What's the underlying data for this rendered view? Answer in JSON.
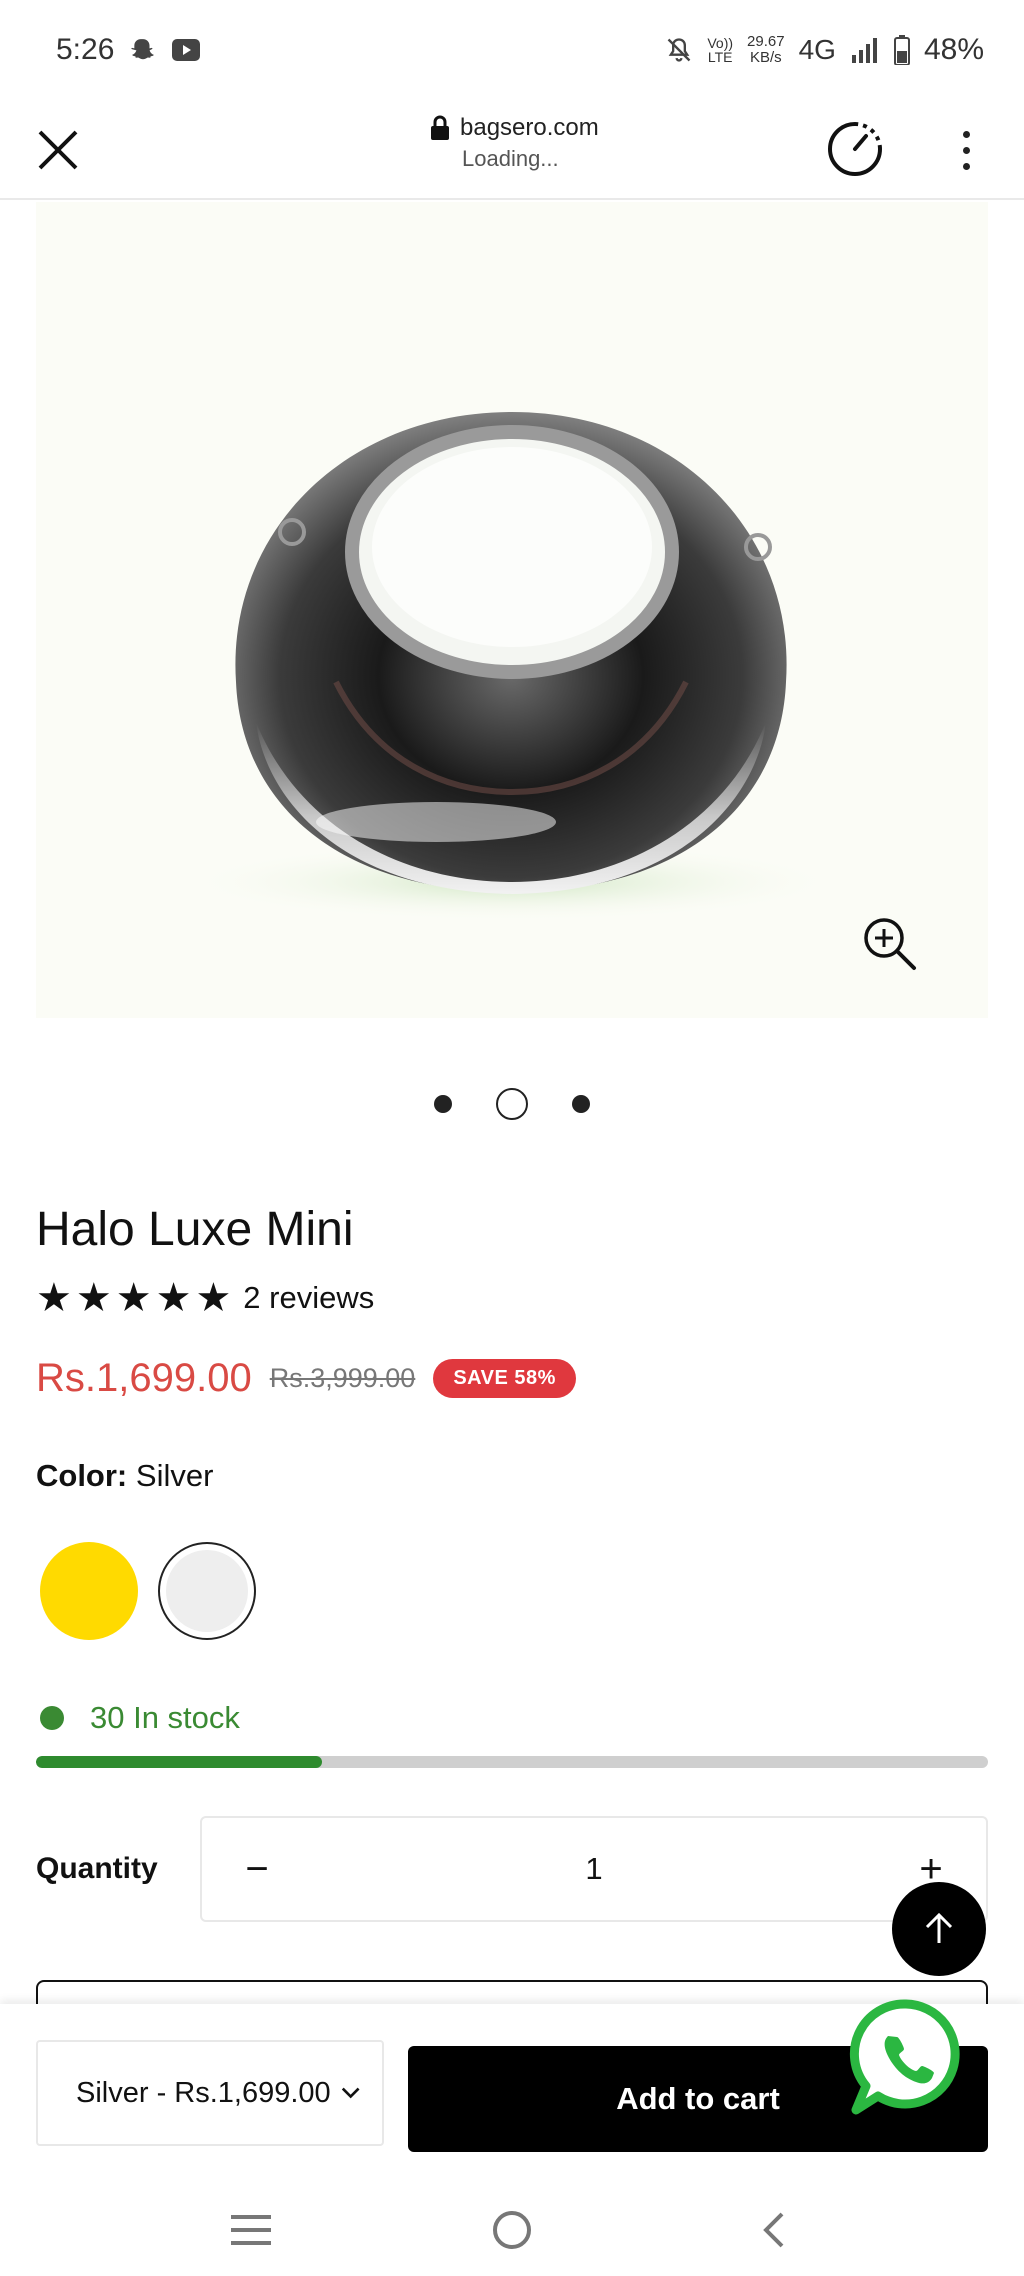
{
  "status_bar": {
    "time": "5:26",
    "volte_top": "Vo))",
    "volte_bottom": "LTE",
    "speed_value": "29.67",
    "speed_unit": "KB/s",
    "network": "4G",
    "battery": "48%"
  },
  "browser": {
    "url": "bagsero.com",
    "status": "Loading..."
  },
  "product": {
    "title": "Halo Luxe Mini",
    "rating_stars": 5,
    "reviews": "2 reviews",
    "price": "Rs.1,699.00",
    "compare_price": "Rs.3,999.00",
    "save_badge": "SAVE  58%",
    "color_label": "Color:",
    "color_value": "Silver",
    "swatches": [
      {
        "name": "Gold",
        "color": "#ffda00"
      },
      {
        "name": "Silver",
        "color": "#eeeeee"
      }
    ],
    "stock_text": "30 In stock",
    "stock_fraction": 0.3,
    "quantity_label": "Quantity",
    "quantity_value": "1",
    "quantity_minus": "−",
    "quantity_plus": "+"
  },
  "gallery": {
    "slide_count": 3,
    "active_index": 1
  },
  "sticky": {
    "variant_selected": "Silver - Rs.1,699.00",
    "add_to_cart": "Add to cart"
  },
  "colors": {
    "price_red": "#d94a44",
    "save_badge": "#e0383e",
    "stock_green": "#3a8a33",
    "whatsapp_green": "#2bb741"
  },
  "icons": {
    "close": "close-icon",
    "lock": "lock-icon",
    "speed": "speedometer-icon",
    "menu": "more-vertical-icon",
    "zoom": "zoom-in-icon",
    "scroll_top": "arrow-up-icon",
    "whatsapp": "whatsapp-icon",
    "chevron": "chevron-down-icon"
  }
}
